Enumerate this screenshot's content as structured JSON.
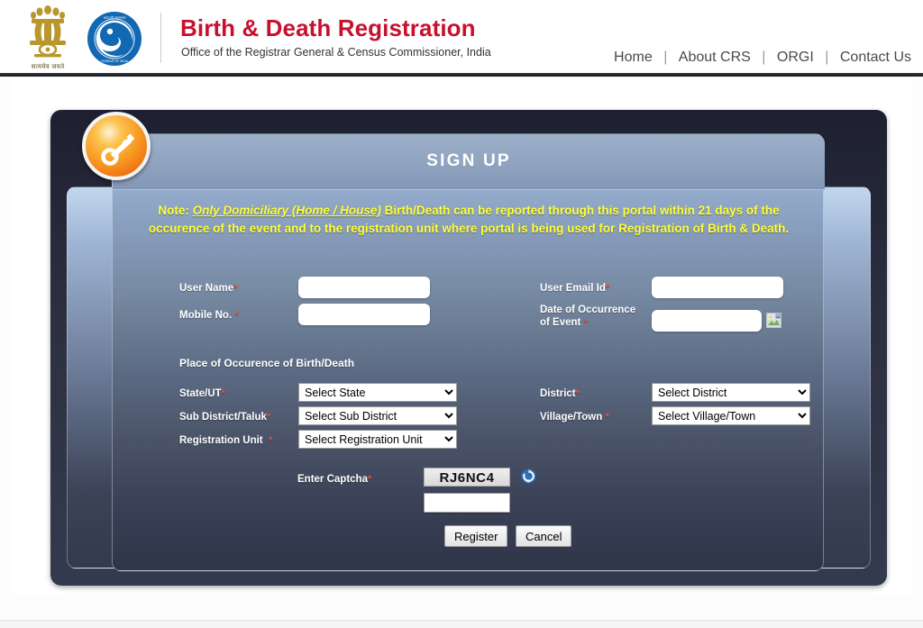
{
  "header": {
    "emblem_caption": "सत्यमेव जयते",
    "emblem_icon": "india-national-emblem-icon",
    "logo_icon": "orgi-census-logo-icon",
    "title": "Birth & Death Registration",
    "subtitle": "Office of the Registrar General & Census Commissioner, India",
    "title_color": "#c8102e",
    "nav": [
      {
        "label": "Home"
      },
      {
        "label": "About CRS"
      },
      {
        "label": "ORGI"
      },
      {
        "label": "Contact Us"
      }
    ],
    "nav_separator": "|"
  },
  "panel": {
    "title": "SIGN UP",
    "badge_icon": "key-icon",
    "note": {
      "prefix": "Note: ",
      "emphasis": "Only Domiciliary (Home / House)",
      "rest": " Birth/Death can be reported through this portal within 21 days of the occurence of the event and to the registration unit where portal is being used for Registration of Birth & Death.",
      "color": "#ffff33"
    }
  },
  "form": {
    "user_name": {
      "label": "User Name",
      "required": "*",
      "value": "",
      "placeholder": ""
    },
    "user_email": {
      "label": "User Email Id",
      "required": "*",
      "value": "",
      "placeholder": ""
    },
    "mobile_no": {
      "label": "Mobile No.",
      "required": "*",
      "value": "",
      "placeholder": ""
    },
    "date_of_occurrence": {
      "label_line1": "Date of Occurrence",
      "label_line2": "of Event",
      "required": "*",
      "value": "",
      "placeholder": "",
      "calendar_icon": "broken-image-calendar-icon"
    },
    "section_place": "Place of Occurence of Birth/Death",
    "state": {
      "label": "State/UT",
      "required": "*",
      "selected": "Select State"
    },
    "district": {
      "label": "District",
      "required": "*",
      "selected": "Select District"
    },
    "sub_district": {
      "label": "Sub District/Taluk",
      "required": "*",
      "selected": "Select Sub District"
    },
    "village": {
      "label": "Village/Town",
      "required": "*",
      "selected": "Select Village/Town"
    },
    "registration_unit": {
      "label": "Registration Unit",
      "required": "*",
      "selected": "Select Registration Unit"
    },
    "captcha": {
      "label": "Enter Captcha",
      "required": "*",
      "code": "RJ6NC4",
      "value": "",
      "refresh_icon": "refresh-icon"
    },
    "buttons": {
      "register": "Register",
      "cancel": "Cancel"
    }
  }
}
